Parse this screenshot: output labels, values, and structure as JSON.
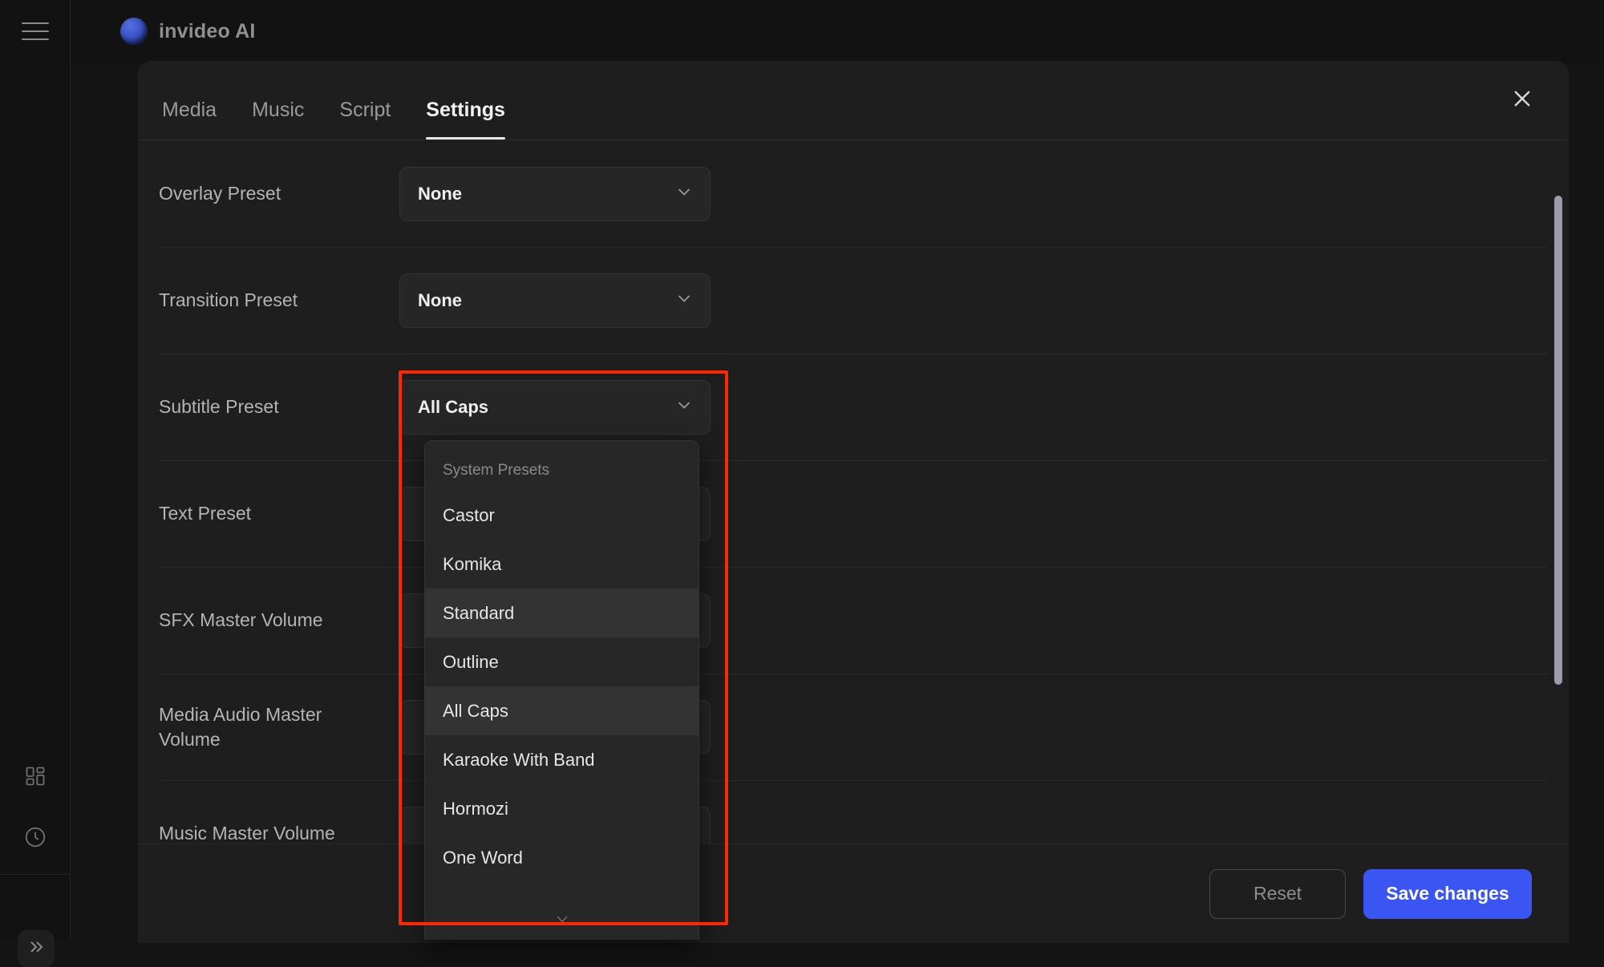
{
  "app": {
    "brand_name": "invideo AI",
    "menu_icon": "hamburger-icon",
    "logo_icon": "invideo-logo-icon"
  },
  "rail": {
    "items": [
      {
        "icon": "grid-dashboard-icon",
        "name": "dashboard"
      },
      {
        "icon": "clock-history-icon",
        "name": "history"
      }
    ],
    "expand_icon": "double-chevron-right-icon"
  },
  "modal": {
    "close_icon": "close-icon",
    "tabs": [
      {
        "label": "Media",
        "active": false
      },
      {
        "label": "Music",
        "active": false
      },
      {
        "label": "Script",
        "active": false
      },
      {
        "label": "Settings",
        "active": true
      }
    ]
  },
  "settings": {
    "rows": [
      {
        "label": "Overlay Preset",
        "type": "select",
        "value": "None",
        "icon": "chevron-down-icon"
      },
      {
        "label": "Transition Preset",
        "type": "select",
        "value": "None",
        "icon": "chevron-down-icon"
      },
      {
        "label": "Subtitle Preset",
        "type": "select",
        "value": "All Caps",
        "icon": "chevron-down-icon"
      },
      {
        "label": "Text Preset",
        "type": "select",
        "value": "",
        "icon": "chevron-down-icon"
      },
      {
        "label": "SFX Master Volume",
        "type": "percent",
        "value": "%"
      },
      {
        "label": "Media Audio Master Volume",
        "type": "percent",
        "value": "%"
      },
      {
        "label": "Music Master Volume",
        "type": "percent",
        "value": "%"
      }
    ]
  },
  "dropdown": {
    "group_label": "System Presets",
    "scroll_hint_icon": "chevron-down-icon",
    "items": [
      {
        "label": "Castor",
        "highlighted": false
      },
      {
        "label": "Komika",
        "highlighted": false
      },
      {
        "label": "Standard",
        "highlighted": true
      },
      {
        "label": "Outline",
        "highlighted": false
      },
      {
        "label": "All Caps",
        "highlighted": true
      },
      {
        "label": "Karaoke With Band",
        "highlighted": false
      },
      {
        "label": "Hormozi",
        "highlighted": false
      },
      {
        "label": "One Word",
        "highlighted": false
      }
    ]
  },
  "footer": {
    "reset_label": "Reset",
    "save_label": "Save changes"
  },
  "annotation": {
    "color": "#fc2800"
  }
}
